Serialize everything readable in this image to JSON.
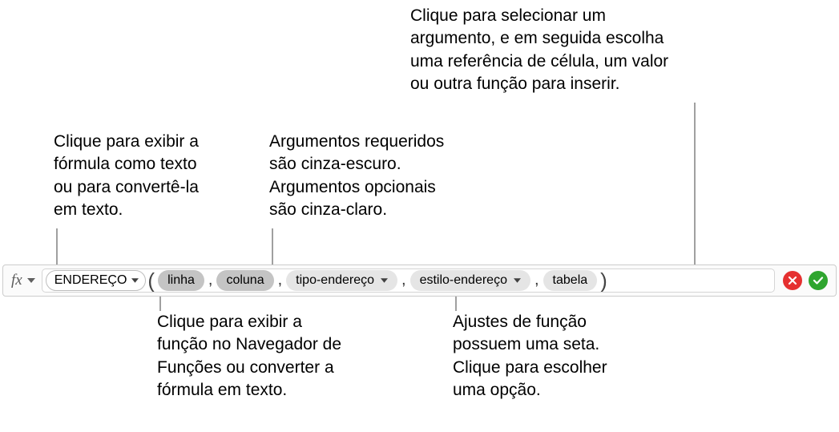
{
  "callouts": {
    "top_right": "Clique para selecionar um\nargumento, e em seguida escolha\numa referência de célula, um valor\nou outra função para inserir.",
    "top_left": "Clique para exibir a\nfórmula como texto\nou para convertê-la\nem texto.",
    "top_center": "Argumentos requeridos\nsão cinza-escuro.\nArgumentos opcionais\nsão cinza-claro.",
    "bottom_left": "Clique para exibir a\nfunção no Navegador de\nFunções ou converter a\nfórmula em texto.",
    "bottom_right": "Ajustes de função\npossuem uma seta.\nClique para escolher\numa opção."
  },
  "formula": {
    "function_name": "ENDEREÇO",
    "args": {
      "linha": "linha",
      "coluna": "coluna",
      "tipo_endereco": "tipo-endereço",
      "estilo_endereco": "estilo-endereço",
      "tabela": "tabela"
    }
  },
  "icons": {
    "fx": "fx"
  }
}
